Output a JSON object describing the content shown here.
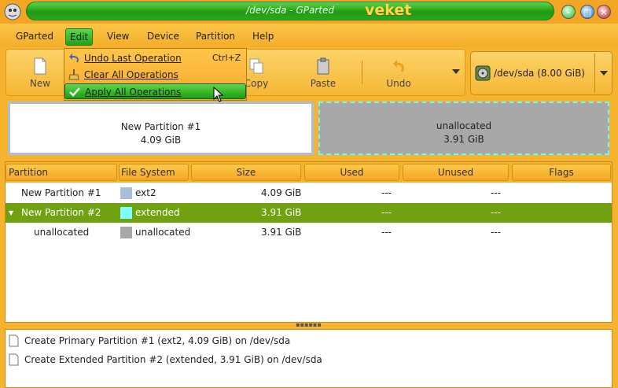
{
  "window": {
    "title": "/dev/sda - GParted",
    "brand": "veket",
    "controls": {
      "minimize": "-",
      "maximize": "□",
      "close": "×"
    }
  },
  "menubar": {
    "items": [
      "GParted",
      "Edit",
      "View",
      "Device",
      "Partition",
      "Help"
    ],
    "active": "Edit"
  },
  "toolbar": {
    "new_label": "New",
    "copy_label": "Copy",
    "paste_label": "Paste",
    "undo_label": "Undo",
    "overflow_icon": "chevron-down-icon"
  },
  "device_selector": {
    "label": "/dev/sda  (8.00 GiB)",
    "icon": "disk-icon"
  },
  "edit_menu": {
    "items": [
      {
        "label": "Undo Last Operation",
        "accel": "Ctrl+Z",
        "icon": "undo-icon"
      },
      {
        "label": "Clear All Operations",
        "accel": "",
        "icon": "broom-icon"
      },
      {
        "label": "Apply All Operations",
        "accel": "",
        "icon": "checkmark-icon"
      }
    ],
    "highlighted_index": 2
  },
  "partition_map": [
    {
      "name": "New Partition #1",
      "size": "4.09 GiB"
    },
    {
      "name": "unallocated",
      "size": "3.91 GiB"
    }
  ],
  "table": {
    "headers": [
      "Partition",
      "File System",
      "Size",
      "Used",
      "Unused",
      "Flags"
    ],
    "rows": [
      {
        "partition": "New Partition #1",
        "fs": "ext2",
        "size": "4.09 GiB",
        "used": "---",
        "unused": "---",
        "flags": "",
        "color": "#a7bfd8",
        "selected": false
      },
      {
        "partition": "New Partition #2",
        "fs": "extended",
        "size": "3.91 GiB",
        "used": "---",
        "unused": "---",
        "flags": "",
        "color": "#7fffff",
        "selected": true
      },
      {
        "partition": "unallocated",
        "fs": "unallocated",
        "size": "3.91 GiB",
        "used": "---",
        "unused": "---",
        "flags": "",
        "color": "#a8a8a8",
        "selected": false
      }
    ]
  },
  "operations": [
    "Create Primary Partition #1 (ext2, 4.09 GiB) on /dev/sda",
    "Create Extended Partition #2 (extended, 3.91 GiB) on /dev/sda"
  ],
  "colors": {
    "accent_green": "#1f9a12",
    "window_bg": "#f5b32e",
    "selection": "#6fa111"
  }
}
